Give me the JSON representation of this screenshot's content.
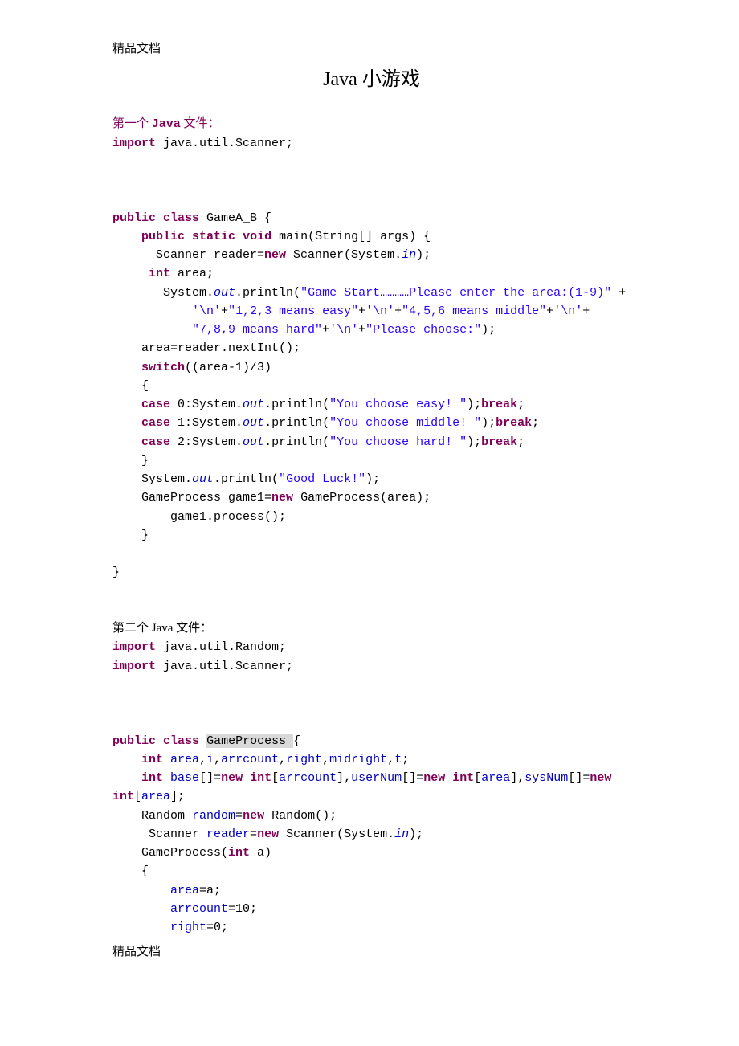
{
  "header_label": "精品文档",
  "title": "Java 小游戏",
  "file1_label_prefix": "第一个 ",
  "file1_label_java": "Java",
  "file1_label_suffix": " 文件：",
  "code1": {
    "l1_import": "import",
    "l1_rest": " java.util.Scanner;",
    "l2_pub": "public",
    "l2_cls": "class",
    "l2_name": " GameA_B {",
    "l3_pub": "public",
    "l3_stat": "static",
    "l3_void": "void",
    "l3_main": " main(String[] args) {",
    "l4_pre": "      Scanner reader=",
    "l4_new": "new",
    "l4_post": " Scanner(System.",
    "l4_in": "in",
    "l4_end": ");",
    "l5_int": "int",
    "l5_area": " area;",
    "l6_pre": "       System.",
    "l6_out": "out",
    "l6_mid": ".println(",
    "l6_str": "\"Game Start…………Please enter the area:(1-9)\"",
    "l6_plus": " +",
    "l7_chr1": "'\\n'",
    "l7_p1": "+",
    "l7_s1": "\"1,2,3 means easy\"",
    "l7_p2": "+",
    "l7_chr2": "'\\n'",
    "l7_p3": "+",
    "l7_s2": "\"4,5,6 means middle\"",
    "l7_p4": "+",
    "l7_chr3": "'\\n'",
    "l7_p5": "+",
    "l8_s1": "\"7,8,9 means hard\"",
    "l8_p1": "+",
    "l8_chr": "'\\n'",
    "l8_p2": "+",
    "l8_s2": "\"Please choose:\"",
    "l8_end": ");",
    "l9": "    area=reader.nextInt();",
    "l10_sw": "switch",
    "l10_rest": "((area-1)/3)",
    "l11": "    {",
    "l12_case": "case",
    "l12_num": " 0:System.",
    "l12_out": "out",
    "l12_mid": ".println(",
    "l12_str": "\"You choose easy! \"",
    "l12_brk": "break",
    "l12_end": ";",
    "l13_case": "case",
    "l13_num": " 1:System.",
    "l13_out": "out",
    "l13_mid": ".println(",
    "l13_str": "\"You choose middle! \"",
    "l13_brk": "break",
    "l14_case": "case",
    "l14_num": " 2:System.",
    "l14_out": "out",
    "l14_mid": ".println(",
    "l14_str": "\"You choose hard! \"",
    "l14_brk": "break",
    "l15": "    }",
    "l16_pre": "    System.",
    "l16_out": "out",
    "l16_mid": ".println(",
    "l16_str": "\"Good Luck!\"",
    "l16_end": ");",
    "l17_pre": "    GameProcess game1=",
    "l17_new": "new",
    "l17_post": " GameProcess(area);",
    "l18": "        game1.process();",
    "l19": "    }",
    "l20": "}"
  },
  "file2_label": "第二个 Java 文件：",
  "code2": {
    "l1_import": "import",
    "l1_rest": " java.util.Random;",
    "l2_import": "import",
    "l2_rest": " java.util.Scanner;",
    "l3_pub": "public",
    "l3_cls": "class",
    "l3_sp": " ",
    "l3_name": "GameProcess ",
    "l3_brace": "{",
    "l4_int": "int",
    "l4_rest": " ",
    "l4_fields": "area",
    "l4_c1": ",",
    "l4_f2": "i",
    "l4_c2": ",",
    "l4_f3": "arrcount",
    "l4_c3": ",",
    "l4_f4": "right",
    "l4_c4": ",",
    "l4_f5": "midright",
    "l4_c5": ",",
    "l4_f6": "t",
    "l4_end": ";",
    "l5_int": "int",
    "l5_sp": " ",
    "l5_base": "base",
    "l5_a": "[]=",
    "l5_new1": "new",
    "l5_sp2": " ",
    "l5_int2": "int",
    "l5_b": "[",
    "l5_arr": "arrcount",
    "l5_c": "],",
    "l5_user": "userNum",
    "l5_d": "[]=",
    "l5_new2": "new",
    "l5_sp3": " ",
    "l5_int3": "int",
    "l5_e": "[",
    "l5_area": "area",
    "l5_f": "],",
    "l5_sys": "sysNum",
    "l5_g": "[]=",
    "l5_new3": "new",
    "l6_int": "int",
    "l6_b": "[",
    "l6_area": "area",
    "l6_end": "];",
    "l7_pre": "    Random ",
    "l7_rand": "random",
    "l7_eq": "=",
    "l7_new": "new",
    "l7_post": " Random();",
    "l8_pre": "     Scanner ",
    "l8_reader": "reader",
    "l8_eq": "=",
    "l8_new": "new",
    "l8_post": " Scanner(System.",
    "l8_in": "in",
    "l8_end": ");",
    "l9_pre": "    GameProcess(",
    "l9_int": "int",
    "l9_post": " a)",
    "l10": "    {",
    "l11_pre": "        ",
    "l11_area": "area",
    "l11_post": "=a;",
    "l12_pre": "        ",
    "l12_arr": "arrcount",
    "l12_post": "=10;",
    "l13_pre": "        ",
    "l13_right": "right",
    "l13_post": "=0;"
  },
  "footer_label": "精品文档"
}
